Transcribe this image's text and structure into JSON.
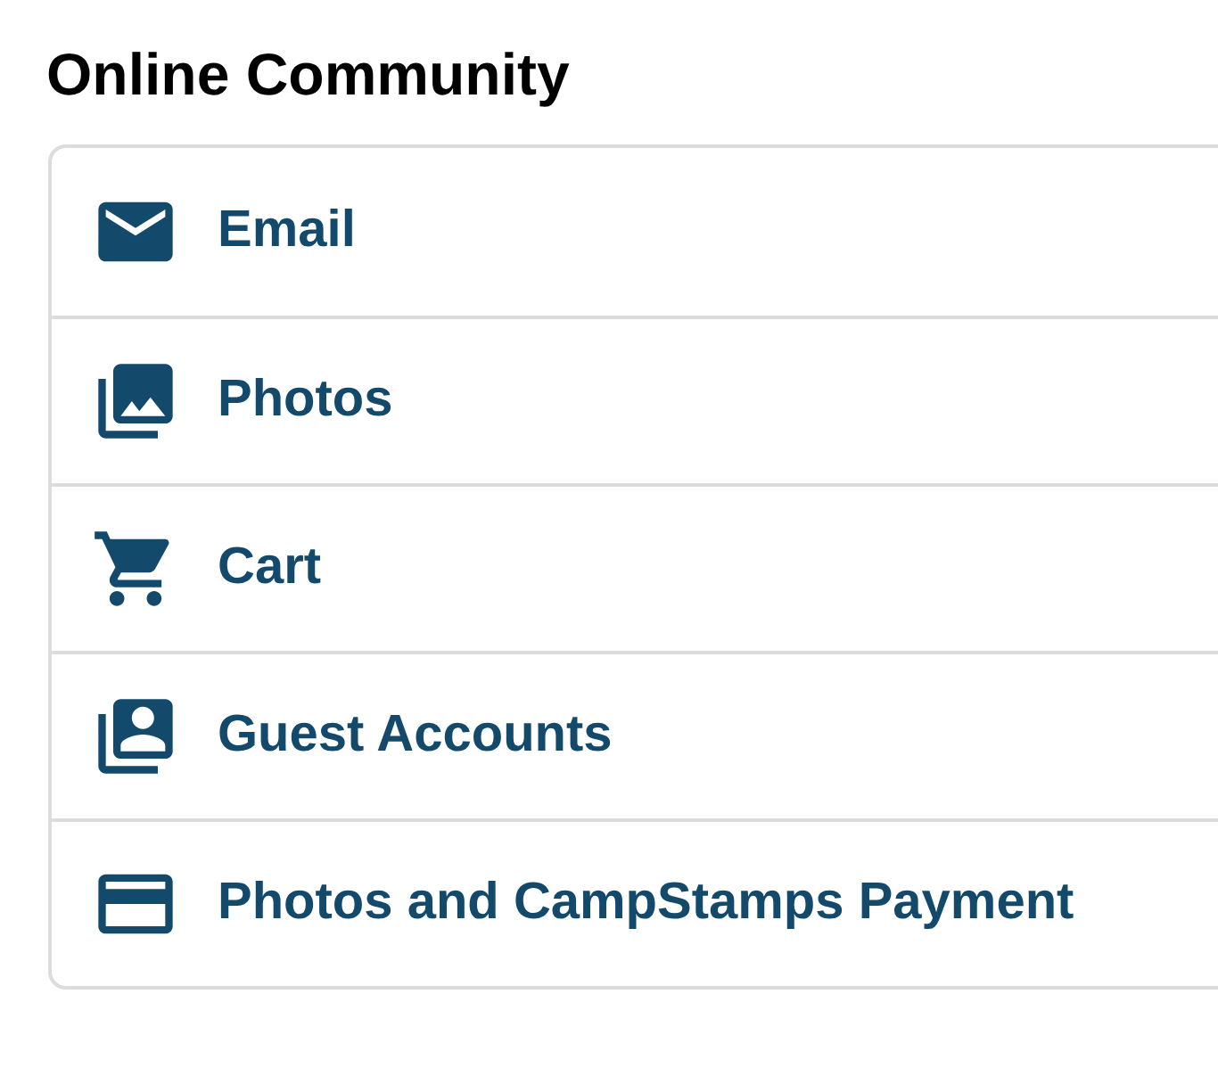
{
  "heading": "Online Community",
  "items": [
    {
      "kind": "email",
      "label": "Email"
    },
    {
      "kind": "photos",
      "label": "Photos"
    },
    {
      "kind": "cart",
      "label": "Cart"
    },
    {
      "kind": "accounts",
      "label": "Guest Accounts"
    },
    {
      "kind": "card",
      "label": "Photos and CampStamps Payment"
    }
  ]
}
